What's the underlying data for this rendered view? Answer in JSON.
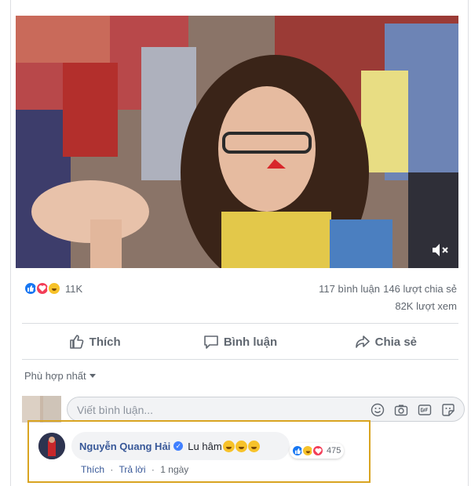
{
  "post": {
    "reactions": {
      "icons": [
        "like-icon",
        "love-icon",
        "haha-icon"
      ],
      "count": "11K"
    },
    "comments_count": "117 bình luận",
    "shares_count": "146 lượt chia sẻ",
    "views_count": "82K lượt xem"
  },
  "actions": {
    "like_label": "Thích",
    "comment_label": "Bình luận",
    "share_label": "Chia sẻ"
  },
  "comments": {
    "sort_label": "Phù hợp nhất",
    "composer_placeholder": "Viết bình luận...",
    "composer_tools": [
      "emoji-icon",
      "camera-icon",
      "gif-icon",
      "sticker-icon"
    ],
    "top_comment": {
      "author": "Nguyễn Quang Hải",
      "verified": true,
      "text": "Lu hâm",
      "emojis": [
        "laughing-emoji",
        "laughing-emoji",
        "laughing-emoji"
      ],
      "reaction_count": "475",
      "like_label": "Thích",
      "reply_label": "Trả lời",
      "time": "1 ngày"
    }
  },
  "colors": {
    "like": "#1877f2",
    "love": "#f33e58",
    "haha": "#f7c22a",
    "link": "#385898",
    "highlight_border": "#d9a421"
  }
}
